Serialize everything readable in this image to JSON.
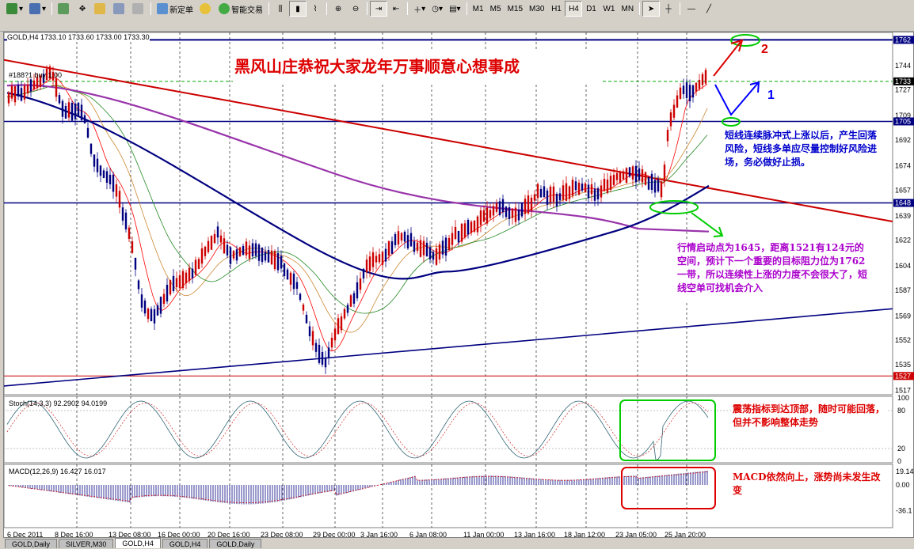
{
  "toolbar": {
    "new_order": "新定单",
    "expert_trading": "智能交易",
    "timeframes": [
      "M1",
      "M5",
      "M15",
      "M30",
      "H1",
      "H4",
      "D1",
      "W1",
      "MN"
    ],
    "active_timeframe": "H4"
  },
  "chart": {
    "header": "GOLD,H4  1733.10 1733.60 1733.00 1733.30",
    "order_label": "#188?1 buy 1.00",
    "price_labels": [
      "1762",
      "1744",
      "1733",
      "1727",
      "1709",
      "1705",
      "1692",
      "1674",
      "1657",
      "1639",
      "1648",
      "1622",
      "1604",
      "1587",
      "1569",
      "1552",
      "1535",
      "1527",
      "1517"
    ],
    "price_markers": {
      "top": "1762",
      "current": "1733",
      "mid": "1705",
      "support": "1648",
      "bottom": "1527"
    },
    "time_labels": [
      "6 Dec 2011",
      "8 Dec 16:00",
      "13 Dec 08:00",
      "16 Dec 00:00",
      "20 Dec 16:00",
      "23 Dec 08:00",
      "29 Dec 00:00",
      "3 Jan 16:00",
      "6 Jan 08:00",
      "11 Jan 00:00",
      "13 Jan 16:00",
      "18 Jan 12:00",
      "23 Jan 05:00",
      "25 Jan 20:00"
    ],
    "banner": "黑风山庄恭祝大家龙年万事顺意心想事成",
    "note1": "短线连续脉冲式上涨以后，产生回落风险，短线多单应尽量控制好风险进场，务必做好止损。",
    "note2": "行情启动点为1645，距离1521有124元的空间，预计下一个重要的目标阻力位为1762一带，所以连续性上涨的力度不会很大了，短线空单可找机会介入",
    "arrow_label_1": "1",
    "arrow_label_2": "2"
  },
  "stoch": {
    "label": "Stoch(14,3,3) 92.2902 94.0199",
    "levels": [
      "100",
      "80",
      "20",
      "0"
    ],
    "note": "震荡指标到达顶部，随时可能回落，但并不影响整体走势"
  },
  "macd": {
    "label": "MACD(12,26,9) 16.427 16.017",
    "levels": [
      "19.14",
      "0.00",
      "-36.1"
    ],
    "note": "MACD依然向上，涨势尚未发生改变"
  },
  "tabs": [
    "GOLD,Daily",
    "SILVER,M30",
    "GOLD,H4",
    "GOLD,H4",
    "GOLD,Daily"
  ],
  "active_tab": 2,
  "colors": {
    "up": "#cc0000",
    "down": "#000080",
    "ma_purple": "#9933aa",
    "ma_navy": "#000080",
    "trend_red": "#cc0000",
    "annotation_green": "#00cc00",
    "annotation_red": "#dd0000",
    "annotation_blue": "#0000ff"
  }
}
